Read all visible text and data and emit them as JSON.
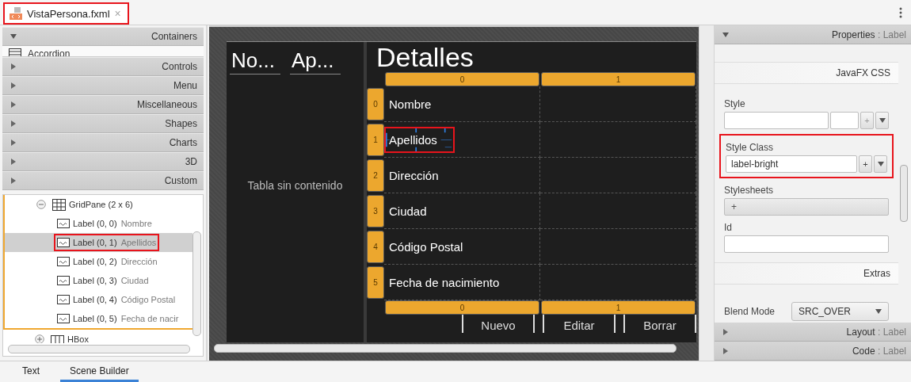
{
  "document_tabs": [
    {
      "label": "VistaPersona.fxml",
      "close": "×",
      "selected": true,
      "highlighted": true
    }
  ],
  "library": [
    {
      "label": "Containers",
      "expanded": true,
      "items": [
        "Accordion"
      ]
    },
    {
      "label": "Controls",
      "expanded": false
    },
    {
      "label": "Menu",
      "expanded": false
    },
    {
      "label": "Miscellaneous",
      "expanded": false
    },
    {
      "label": "Shapes",
      "expanded": false
    },
    {
      "label": "Charts",
      "expanded": false
    },
    {
      "label": "3D",
      "expanded": false
    },
    {
      "label": "Custom",
      "expanded": false
    }
  ],
  "hierarchy": [
    {
      "kind": "grid",
      "label": "GridPane (2 x 6)",
      "expanded": true,
      "children": [
        {
          "kind": "label",
          "label": "Label (0, 0)",
          "text": "Nombre",
          "selected": false,
          "highlighted": false
        },
        {
          "kind": "label",
          "label": "Label (0, 1)",
          "text": "Apellidos",
          "selected": true,
          "highlighted": true
        },
        {
          "kind": "label",
          "label": "Label (0, 2)",
          "text": "Dirección",
          "selected": false,
          "highlighted": false
        },
        {
          "kind": "label",
          "label": "Label (0, 3)",
          "text": "Ciudad",
          "selected": false,
          "highlighted": false
        },
        {
          "kind": "label",
          "label": "Label (0, 4)",
          "text": "Código Postal",
          "selected": false,
          "highlighted": false
        },
        {
          "kind": "label",
          "label": "Label (0, 5)",
          "text": "Fecha de nacir",
          "selected": false,
          "highlighted": false
        }
      ]
    },
    {
      "kind": "hbox",
      "label": "HBox",
      "expanded": false
    }
  ],
  "canvas": {
    "table": {
      "columns": [
        "No...",
        "Ap..."
      ],
      "placeholder": "Tabla sin contenido"
    },
    "title": "Detalles",
    "grid": {
      "top_headers": [
        "0",
        "1"
      ],
      "rows": [
        {
          "index": "0",
          "label": "Nombre",
          "selected": false,
          "highlighted": false
        },
        {
          "index": "1",
          "label": "Apellidos",
          "selected": true,
          "highlighted": true
        },
        {
          "index": "2",
          "label": "Dirección",
          "selected": false,
          "highlighted": false
        },
        {
          "index": "3",
          "label": "Ciudad",
          "selected": false,
          "highlighted": false
        },
        {
          "index": "4",
          "label": "Código Postal",
          "selected": false,
          "highlighted": false
        },
        {
          "index": "5",
          "label": "Fecha de nacimiento",
          "selected": false,
          "highlighted": false
        }
      ],
      "bottom_headers": [
        "0",
        "1"
      ]
    },
    "buttons": [
      "Nuevo",
      "Editar",
      "Borrar"
    ]
  },
  "properties": {
    "title": "Properties",
    "subject": ": Label",
    "css_heading": "JavaFX CSS",
    "style": {
      "label": "Style",
      "add": "+",
      "add_disabled": true
    },
    "style_class": {
      "label": "Style Class",
      "value": "label-bright",
      "add": "+",
      "add_disabled": false,
      "highlighted": true
    },
    "stylesheets": {
      "label": "Stylesheets",
      "add": "+"
    },
    "id": {
      "label": "Id"
    },
    "extras_heading": "Extras",
    "blend_mode": {
      "label": "Blend Mode",
      "value": "SRC_OVER"
    }
  },
  "collapsed_panels": [
    {
      "title": "Layout",
      "subject": ": Label"
    },
    {
      "title": "Code",
      "subject": ": Label"
    }
  ],
  "bottom_tabs": [
    {
      "label": "Text",
      "selected": false
    },
    {
      "label": "Scene Builder",
      "selected": true
    }
  ]
}
